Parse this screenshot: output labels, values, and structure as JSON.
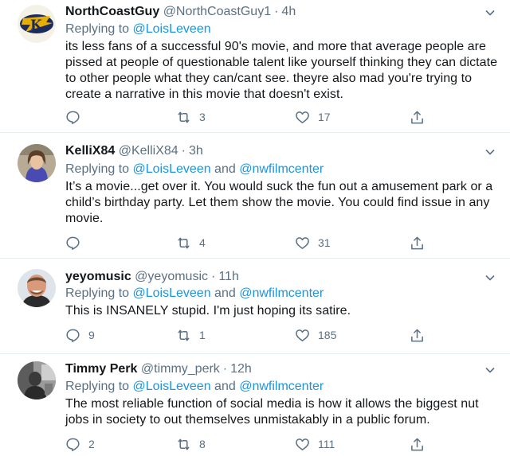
{
  "tweets": [
    {
      "name": "NorthCoastGuy",
      "handle": "@NorthCoastGuy1",
      "sep": "·",
      "time": "4h",
      "replying_prefix": "Replying to",
      "mentions": [
        "@LoisLeveen"
      ],
      "mention_joiner": "",
      "text": "its less fans of a successful 90's movie, and more that average people are pissed at people of questionable talent like yourself thinking they can dictate to other people what they can/cant see. theyre also mad you're trying to create a narrative in this movie that doesn't exist.",
      "replies": "",
      "retweets": "3",
      "likes": "17",
      "avatar_icon": "golden-flashes-logo-icon"
    },
    {
      "name": "KelliX84",
      "handle": "@KelliX84",
      "sep": "·",
      "time": "3h",
      "replying_prefix": "Replying to",
      "mentions": [
        "@LoisLeveen",
        "@nwfilmcenter"
      ],
      "mention_joiner": "and",
      "text": "It’s a movie...get over it. You would suck the fun out a amusement park or a child’s birthday party. Let them show the movie. You could find issue in any movie.",
      "replies": "",
      "retweets": "4",
      "likes": "31",
      "avatar_icon": "profile-photo"
    },
    {
      "name": "yeyomusic",
      "handle": "@yeyomusic",
      "sep": "·",
      "time": "11h",
      "replying_prefix": "Replying to",
      "mentions": [
        "@LoisLeveen",
        "@nwfilmcenter"
      ],
      "mention_joiner": "and",
      "text": "This is INSANELY stupid. I'm just hoping its satire.",
      "replies": "9",
      "retweets": "1",
      "likes": "185",
      "avatar_icon": "profile-photo"
    },
    {
      "name": "Timmy Perk",
      "handle": "@timmy_perk",
      "sep": "·",
      "time": "12h",
      "replying_prefix": "Replying to",
      "mentions": [
        "@LoisLeveen",
        "@nwfilmcenter"
      ],
      "mention_joiner": "and",
      "text": "The most reliable function of social media is how it allows the biggest nut jobs in society to out themselves unmistakably in a public forum.",
      "replies": "2",
      "retweets": "8",
      "likes": "111",
      "avatar_icon": "profile-photo"
    }
  ],
  "icons": {
    "reply": "reply-icon",
    "retweet": "retweet-icon",
    "like": "heart-icon",
    "share": "share-icon",
    "menu": "chevron-down-icon"
  },
  "colors": {
    "link": "#1b95e0",
    "muted": "#5b7083",
    "text": "#14171a",
    "divider": "#e6ecf0"
  }
}
